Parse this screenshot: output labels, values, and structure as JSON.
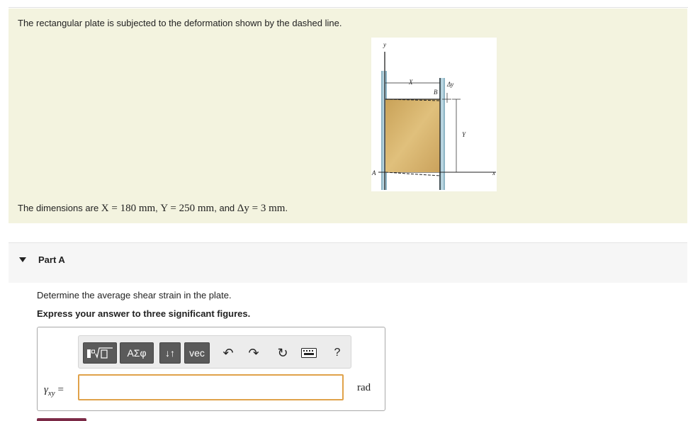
{
  "problem": {
    "intro": "The rectangular plate is subjected to the deformation shown by the dashed line.",
    "dims_prefix": "The dimensions are ",
    "dims_x": "X = 180 mm",
    "dims_sep1": ", ",
    "dims_y": "Y = 250 mm",
    "dims_sep2": ", and ",
    "dims_dy": "Δy = 3 mm",
    "dims_end": "."
  },
  "figure": {
    "label_y_axis": "y",
    "label_x_dim": "X",
    "label_dy": "Δy",
    "label_b": "B",
    "label_y_dim": "Y",
    "label_a": "A",
    "label_x_axis": "x"
  },
  "part_a": {
    "label": "Part A",
    "question": "Determine the average shear strain in the plate.",
    "instruction": "Express your answer to three significant figures."
  },
  "toolbar": {
    "templates_icon": "template-icon",
    "greek_label": "ΑΣφ",
    "arrows_label": "↓↑",
    "vec_label": "vec",
    "undo_icon": "↶",
    "redo_icon": "↷",
    "reset_icon": "↻",
    "keyboard_icon": "keyboard-icon",
    "help_label": "?"
  },
  "answer": {
    "variable": "γ",
    "variable_sub": "xy",
    "equals": " =",
    "value": "",
    "unit": "rad"
  },
  "colors": {
    "problem_bg": "#f3f3df",
    "input_border": "#e0a24a",
    "plate": "#d8b56a",
    "wall": "#9ec3d3",
    "submit": "#7b2a46"
  }
}
